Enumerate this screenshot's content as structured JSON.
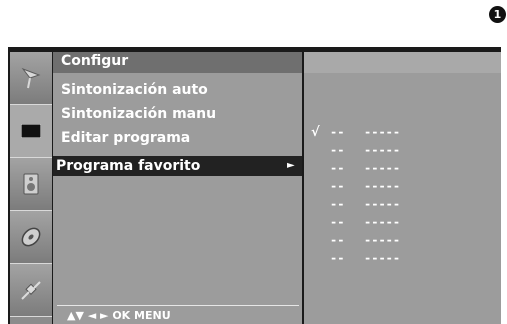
{
  "step_badge": "1",
  "sidebar": {
    "icons": [
      {
        "name": "satellite-dish-icon",
        "active": false
      },
      {
        "name": "screen-icon",
        "active": true
      },
      {
        "name": "speaker-icon",
        "active": false
      },
      {
        "name": "disc-icon",
        "active": false
      },
      {
        "name": "satellite-icon",
        "active": false
      }
    ]
  },
  "menu": {
    "title": "Configur",
    "items": [
      {
        "label": "Sintonización auto"
      },
      {
        "label": "Sintonización manu"
      },
      {
        "label": "Editar programa"
      },
      {
        "label": "Programa favorito",
        "arrow": "►"
      }
    ],
    "footer": "▲▼  ◄ ►  OK  MENU"
  },
  "favorites": {
    "check": "√",
    "rows": [
      {
        "num": "--",
        "name": "-----"
      },
      {
        "num": "--",
        "name": "-----"
      },
      {
        "num": "--",
        "name": "-----"
      },
      {
        "num": "--",
        "name": "-----"
      },
      {
        "num": "--",
        "name": "-----"
      },
      {
        "num": "--",
        "name": "-----"
      },
      {
        "num": "--",
        "name": "-----"
      },
      {
        "num": "--",
        "name": "-----"
      }
    ]
  },
  "colors": {
    "panel": "#9c9c9c",
    "header": "#6f6f6f",
    "selected": "#222222",
    "text": "#ffffff"
  }
}
